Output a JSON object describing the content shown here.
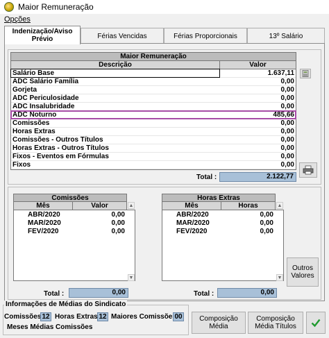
{
  "window": {
    "title": "Maior Remuneração"
  },
  "menu": {
    "opcoes": "Opções"
  },
  "tabs": [
    {
      "label": "Indenização/Aviso Prévio"
    },
    {
      "label": "Férias Vencidas"
    },
    {
      "label": "Férias Proporcionais"
    },
    {
      "label": "13º Salário"
    }
  ],
  "main_grid": {
    "title": "Maior Remuneração",
    "col_descricao": "Descrição",
    "col_valor": "Valor",
    "rows": [
      {
        "desc": "Salário Base",
        "valor": "1.637,11"
      },
      {
        "desc": "ADC Salário Família",
        "valor": "0,00"
      },
      {
        "desc": "Gorjeta",
        "valor": "0,00"
      },
      {
        "desc": "ADC Periculosidade",
        "valor": "0,00"
      },
      {
        "desc": "ADC Insalubridade",
        "valor": "0,00"
      },
      {
        "desc": "ADC Noturno",
        "valor": "485,66"
      },
      {
        "desc": "Comissões",
        "valor": "0,00"
      },
      {
        "desc": "Horas Extras",
        "valor": "0,00"
      },
      {
        "desc": "Comissões - Outros Títulos",
        "valor": "0,00"
      },
      {
        "desc": "Horas Extras - Outros Títulos",
        "valor": "0,00"
      },
      {
        "desc": "Fixos - Eventos em Fórmulas",
        "valor": "0,00"
      },
      {
        "desc": "Fixos",
        "valor": "0,00"
      }
    ],
    "total_label": "Total :",
    "total_value": "2.122,77"
  },
  "comissoes": {
    "title": "Comissões",
    "col_mes": "Mês",
    "col_valor": "Valor",
    "rows": [
      {
        "mes": "ABR/2020",
        "valor": "0,00"
      },
      {
        "mes": "MAR/2020",
        "valor": "0,00"
      },
      {
        "mes": "FEV/2020",
        "valor": "0,00"
      }
    ],
    "total_label": "Total :",
    "total_value": "0,00"
  },
  "horas_extras": {
    "title": "Horas Extras",
    "col_mes": "Mês",
    "col_horas": "Horas",
    "rows": [
      {
        "mes": "ABR/2020",
        "horas": "0,00"
      },
      {
        "mes": "MAR/2020",
        "horas": "0,00"
      },
      {
        "mes": "FEV/2020",
        "horas": "0,00"
      }
    ],
    "total_label": "Total :",
    "total_value": "0,00"
  },
  "buttons": {
    "outros_valores": "Outros Valores",
    "composicao_media": "Composição Média",
    "composicao_media_titulos": "Composição Média Títulos"
  },
  "sindicato": {
    "title": "Informações de Médias do Sindicato",
    "comissoes_label": "Comissões",
    "comissoes_value": "12",
    "horas_extras_label": "Horas Extras",
    "horas_extras_value": "12",
    "maiores_comissoes_label": "Maiores Comissões",
    "maiores_comissoes_value": "00",
    "meses_medias_label": "Meses Médias Comissões"
  },
  "colors": {
    "accent_highlight": "#a64ca6",
    "total_fill": "#a8c0d8"
  }
}
